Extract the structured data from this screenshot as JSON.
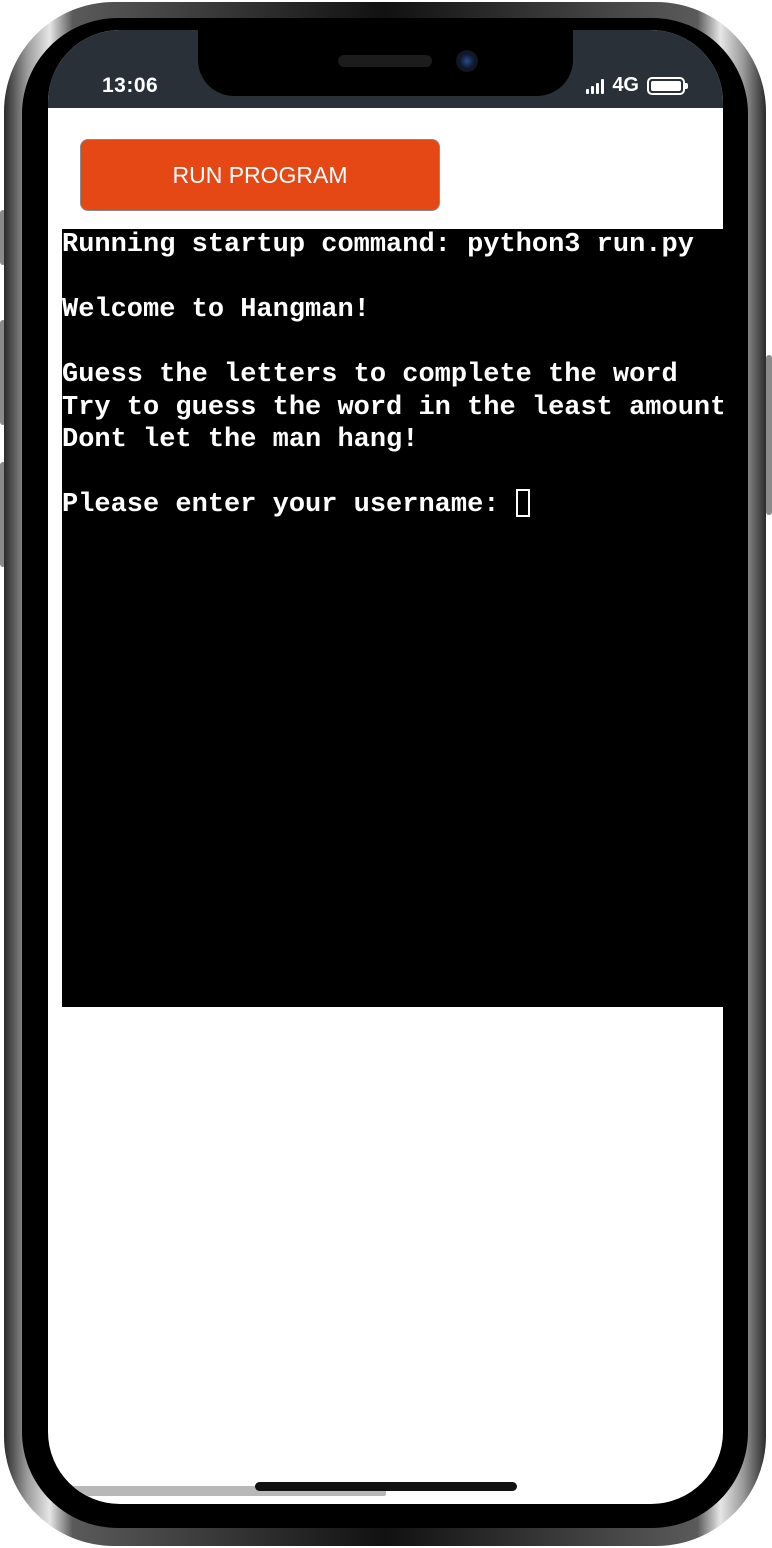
{
  "status_bar": {
    "time": "13:06",
    "network": "4G",
    "icons": [
      "signal-icon",
      "battery-icon"
    ]
  },
  "toolbar": {
    "run_label": "RUN PROGRAM"
  },
  "terminal": {
    "lines": [
      "Running startup command: python3 run.py",
      "",
      "Welcome to Hangman!",
      "",
      "Guess the letters to complete the word",
      "Try to guess the word in the least amount",
      "Dont let the man hang!",
      "",
      "Please enter your username: "
    ],
    "input_value": ""
  },
  "colors": {
    "run_button": "#e54814",
    "terminal_bg": "#000000",
    "terminal_text": "#ffffff",
    "status_bar_bg": "#2a3038"
  }
}
